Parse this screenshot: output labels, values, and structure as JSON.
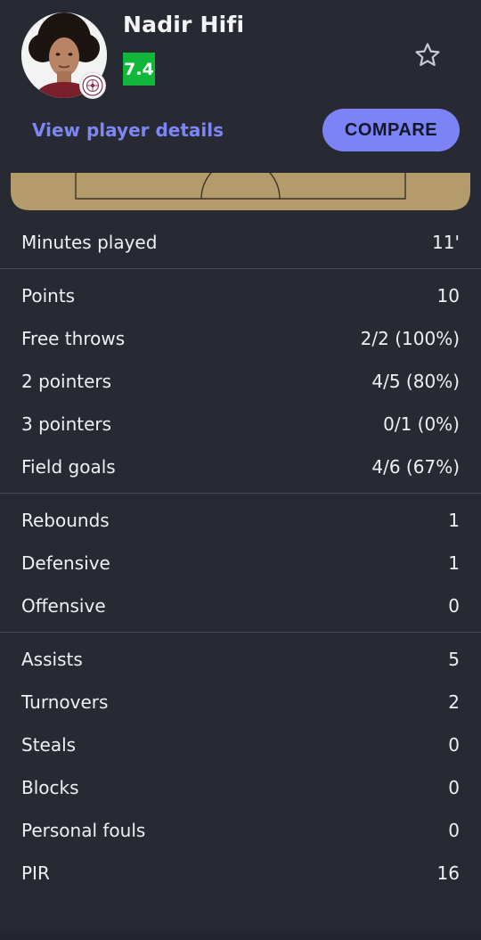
{
  "player": {
    "name": "Nadir Hifi",
    "rating": "7.4",
    "rating_color": "#11b73a"
  },
  "actions": {
    "details_label": "View player details",
    "compare_label": "COMPARE"
  },
  "icons": {
    "favorite": "star-outline-icon",
    "team": "team-logo-icon"
  },
  "stats": {
    "minutes": {
      "label": "Minutes played",
      "value": "11'"
    },
    "points": {
      "label": "Points",
      "value": "10"
    },
    "free_throws": {
      "label": "Free throws",
      "value": "2/2 (100%)"
    },
    "two_pointers": {
      "label": "2 pointers",
      "value": "4/5 (80%)"
    },
    "three_pointers": {
      "label": "3 pointers",
      "value": "0/1 (0%)"
    },
    "field_goals": {
      "label": "Field goals",
      "value": "4/6 (67%)"
    },
    "rebounds": {
      "label": "Rebounds",
      "value": "1"
    },
    "defensive": {
      "label": "Defensive",
      "value": "1"
    },
    "offensive": {
      "label": "Offensive",
      "value": "0"
    },
    "assists": {
      "label": "Assists",
      "value": "5"
    },
    "turnovers": {
      "label": "Turnovers",
      "value": "2"
    },
    "steals": {
      "label": "Steals",
      "value": "0"
    },
    "blocks": {
      "label": "Blocks",
      "value": "0"
    },
    "personal_fouls": {
      "label": "Personal fouls",
      "value": "0"
    },
    "pir": {
      "label": "PIR",
      "value": "16"
    }
  }
}
